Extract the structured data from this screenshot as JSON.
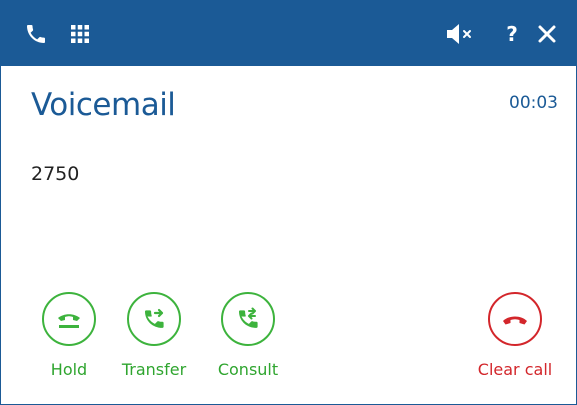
{
  "window": {
    "title_icons": [
      "phone-icon",
      "keypad-icon",
      "speaker-muted-icon",
      "help-icon",
      "close-icon"
    ],
    "help_glyph": "?"
  },
  "call": {
    "title": "Voicemail",
    "timer": "00:03",
    "number": "2750"
  },
  "actions": {
    "hold": "Hold",
    "transfer": "Transfer",
    "consult": "Consult",
    "clear": "Clear call"
  },
  "colors": {
    "titlebar": "#1b5a96",
    "accent_blue": "#1b5a96",
    "action_green": "#3db33d",
    "clear_red": "#d3262b"
  }
}
